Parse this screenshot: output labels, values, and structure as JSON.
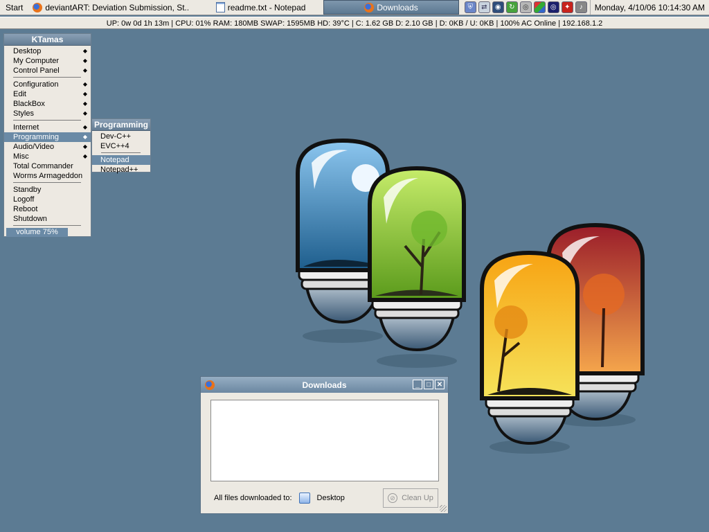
{
  "taskbar": {
    "start_label": "Start",
    "tasks": [
      {
        "label": "deviantART: Deviation Submission, St...",
        "icon": "firefox-icon"
      },
      {
        "label": "readme.txt - Notepad",
        "icon": "notepad-icon"
      },
      {
        "label": "Downloads",
        "icon": "firefox-icon",
        "active": true
      }
    ],
    "tray_icons": [
      "shield-icon",
      "network-icon",
      "globe-icon",
      "refresh-icon",
      "disc-icon",
      "color-icon",
      "target-icon",
      "flag-icon",
      "speaker-icon"
    ],
    "clock": "Monday, 4/10/06 10:14:30 AM"
  },
  "statusbar": {
    "text": "UP: 0w 0d 1h 13m | CPU: 01% RAM: 180MB SWAP: 1595MB HD: 39°C | C: 1.62 GB D: 2.10 GB | D: 0KB / U: 0KB | 100% AC Online | 192.168.1.2"
  },
  "root_menu": {
    "title": "KTamas",
    "items": [
      {
        "label": "Desktop",
        "submenu": true
      },
      {
        "label": "My Computer",
        "submenu": true
      },
      {
        "label": "Control Panel",
        "submenu": true
      },
      {
        "label": "Configuration",
        "submenu": true
      },
      {
        "label": "Edit",
        "submenu": true
      },
      {
        "label": "BlackBox",
        "submenu": true
      },
      {
        "label": "Styles",
        "submenu": true
      },
      {
        "label": "Internet",
        "submenu": true
      },
      {
        "label": "Programming",
        "submenu": true,
        "active": true
      },
      {
        "label": "Audio/Video",
        "submenu": true
      },
      {
        "label": "Misc",
        "submenu": true
      },
      {
        "label": "Total Commander",
        "submenu": false
      },
      {
        "label": "Worms Armageddon",
        "submenu": false
      },
      {
        "label": "Standby",
        "submenu": false
      },
      {
        "label": "Logoff",
        "submenu": false
      },
      {
        "label": "Reboot",
        "submenu": false
      },
      {
        "label": "Shutdown",
        "submenu": false
      }
    ],
    "volume": "volume 75%"
  },
  "programming_menu": {
    "title": "Programming",
    "items": [
      {
        "label": "Dev-C++"
      },
      {
        "label": "EVC++4"
      },
      {
        "label": "Notepad",
        "active": true
      },
      {
        "label": "Notepad++"
      }
    ]
  },
  "downloads_window": {
    "title": "Downloads",
    "files_label": "All files downloaded to:",
    "folder": "Desktop",
    "cleanup_label": "Clean Up",
    "minimize": "_",
    "maximize": "□",
    "close": "✕"
  },
  "colors": {
    "desktop": "#5c7b93",
    "accent": "#6a8aa6"
  }
}
